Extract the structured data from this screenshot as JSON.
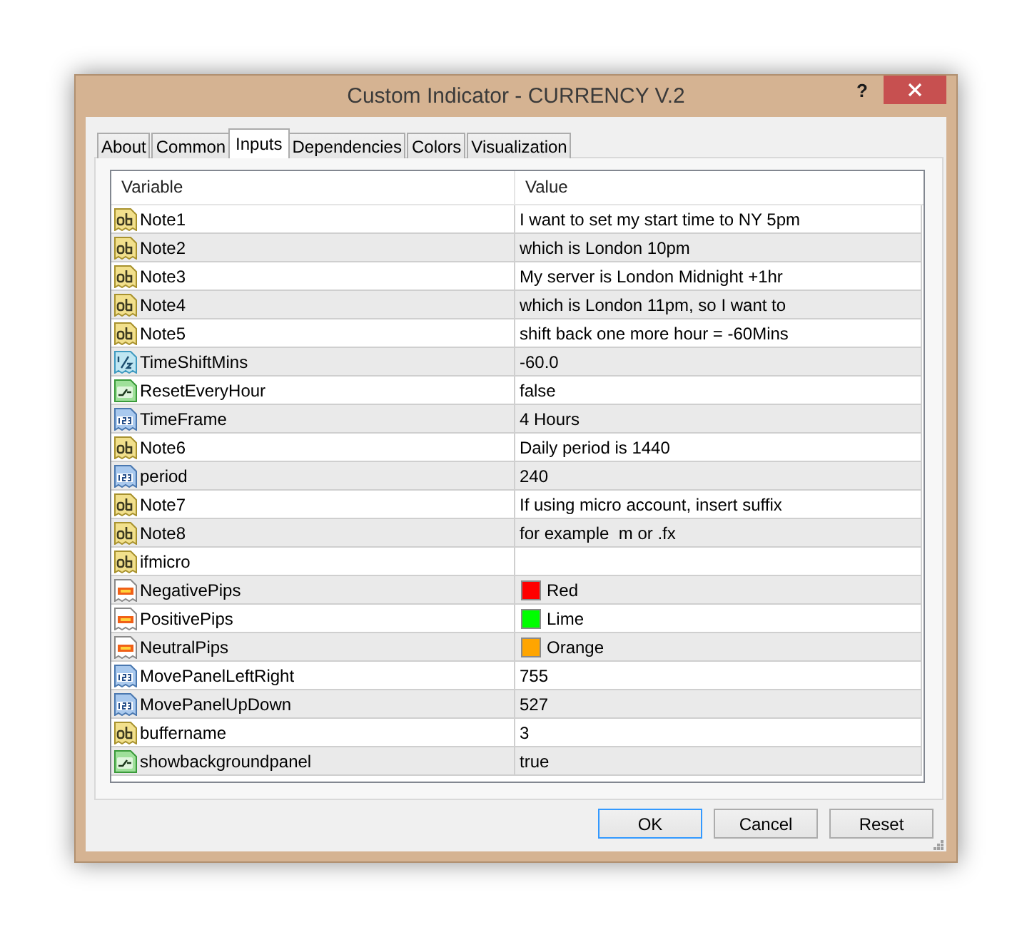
{
  "window": {
    "title": "Custom Indicator - CURRENCY V.2",
    "help_button": "?"
  },
  "tabs": [
    {
      "label": "About",
      "selected": false
    },
    {
      "label": "Common",
      "selected": false
    },
    {
      "label": "Inputs",
      "selected": true
    },
    {
      "label": "Dependencies",
      "selected": false
    },
    {
      "label": "Colors",
      "selected": false
    },
    {
      "label": "Visualization",
      "selected": false
    }
  ],
  "table": {
    "columns": [
      "Variable",
      "Value"
    ],
    "rows": [
      {
        "kind": "string",
        "variable": "Note1",
        "value": "I want to set my start time to NY 5pm"
      },
      {
        "kind": "string",
        "variable": "Note2",
        "value": "which is London 10pm"
      },
      {
        "kind": "string",
        "variable": "Note3",
        "value": "My server is London Midnight +1hr"
      },
      {
        "kind": "string",
        "variable": "Note4",
        "value": "which is London 11pm, so I want to"
      },
      {
        "kind": "string",
        "variable": "Note5",
        "value": "shift back one more hour = -60Mins"
      },
      {
        "kind": "double",
        "variable": "TimeShiftMins",
        "value": "-60.0"
      },
      {
        "kind": "bool",
        "variable": "ResetEveryHour",
        "value": "false"
      },
      {
        "kind": "int",
        "variable": "TimeFrame",
        "value": "4 Hours"
      },
      {
        "kind": "string",
        "variable": "Note6",
        "value": "Daily period is 1440"
      },
      {
        "kind": "int",
        "variable": "period",
        "value": "240"
      },
      {
        "kind": "string",
        "variable": "Note7",
        "value": "If using micro account, insert suffix"
      },
      {
        "kind": "string",
        "variable": "Note8",
        "value": "for example  m or .fx"
      },
      {
        "kind": "string",
        "variable": "ifmicro"
      },
      {
        "kind": "color",
        "variable": "NegativePips",
        "value": "Red",
        "color": "#ff0000"
      },
      {
        "kind": "color",
        "variable": "PositivePips",
        "value": "Lime",
        "color": "#00ff00"
      },
      {
        "kind": "color",
        "variable": "NeutralPips",
        "value": "Orange",
        "color": "#ffa500"
      },
      {
        "kind": "int",
        "variable": "MovePanelLeftRight",
        "value": "755"
      },
      {
        "kind": "int",
        "variable": "MovePanelUpDown",
        "value": "527"
      },
      {
        "kind": "string",
        "variable": "buffername",
        "value": "3"
      },
      {
        "kind": "bool",
        "variable": "showbackgroundpanel",
        "value": "true"
      }
    ]
  },
  "buttons": [
    {
      "label": "OK",
      "default": true
    },
    {
      "label": "Cancel",
      "default": false
    },
    {
      "label": "Reset",
      "default": false
    }
  ]
}
